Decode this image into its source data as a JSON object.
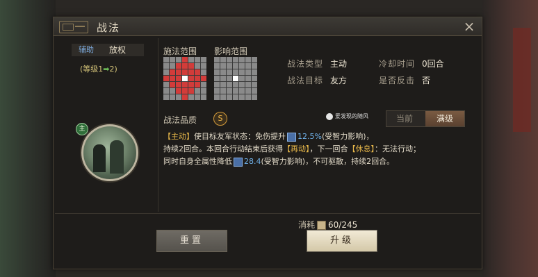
{
  "title": "战法",
  "close_icon": "×",
  "left_panel": {
    "tab_support": "辅助",
    "tactic_name": "放权",
    "level_prefix": "(等级1",
    "level_arrow": "➡",
    "level_suffix": "2)",
    "portrait_badge": "主"
  },
  "grids": {
    "cast_range_label": "施法范围",
    "effect_range_label": "影响范围"
  },
  "info": {
    "type_label": "战法类型",
    "type_value": "主动",
    "cooldown_label": "冷却时间",
    "cooldown_value": "0回合",
    "target_label": "战法目标",
    "target_value": "友方",
    "counter_label": "是否反击",
    "counter_value": "否"
  },
  "quality": {
    "label": "战法品质",
    "value": "S"
  },
  "watermark": "爱发现的随风",
  "toggle": {
    "current": "当前",
    "max": "满级"
  },
  "description": {
    "tag_active": "【主动】",
    "part1": "使目标友军",
    "part1b": "状态：免伤提升",
    "val1": "12.5%",
    "part2": "(受智力影响)，",
    "part3": "持续2回合。本回合行动结束后获得",
    "tag_reactivate": "【再动】",
    "part4": "，下一回合",
    "tag_rest": "【休息】",
    "part5": "：无法行动；",
    "part6": "同时自身全属性降低",
    "val2": "28.4",
    "part7": "(受智力影响)，不可驱散，持续2回合。"
  },
  "cost": {
    "label": "消耗",
    "value": "60/245"
  },
  "buttons": {
    "reset": "重置",
    "upgrade": "升级"
  },
  "colors": {
    "accent_gold": "#e8b84a",
    "value_blue": "#6fb0e8",
    "range_red": "#d23c3a"
  }
}
